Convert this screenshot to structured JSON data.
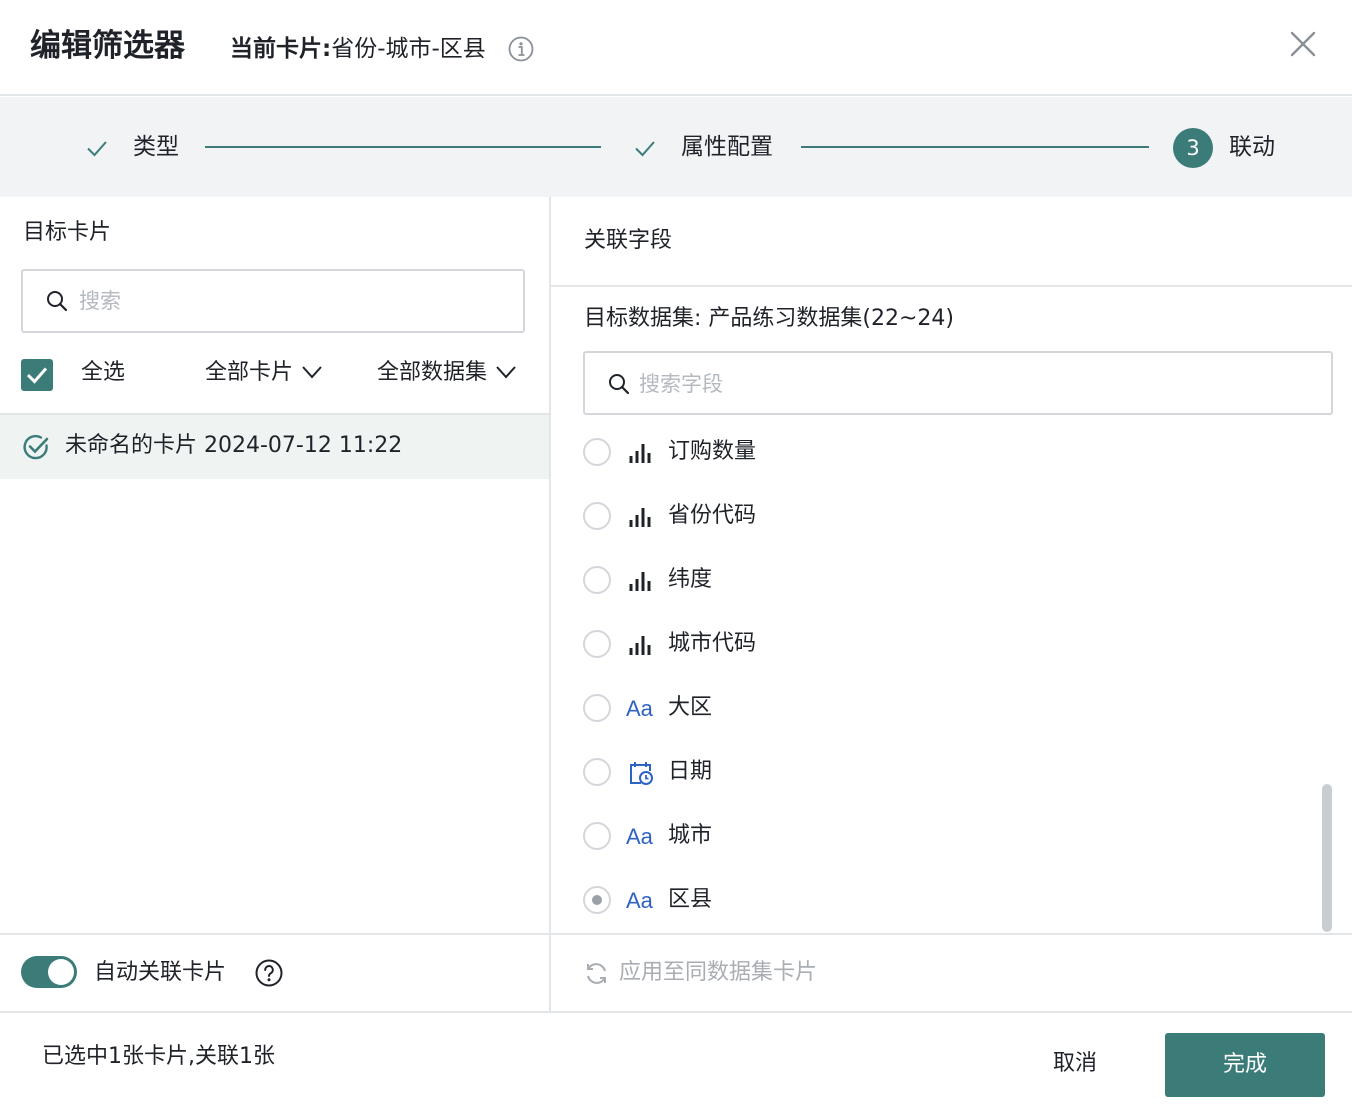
{
  "dialog": {
    "title": "编辑筛选器",
    "current_card_label": "当前卡片:",
    "current_card_value": "省份-城市-区县"
  },
  "steps": [
    {
      "label": "类型",
      "status": "done"
    },
    {
      "label": "属性配置",
      "status": "done"
    },
    {
      "number": "3",
      "label": "联动",
      "status": "active"
    }
  ],
  "left": {
    "title": "目标卡片",
    "search_placeholder": "搜索",
    "select_all_label": "全选",
    "select_all_checked": true,
    "filter_cards": "全部卡片",
    "filter_datasets": "全部数据集",
    "cards": [
      {
        "name": "未命名的卡片 2024-07-12 11:22",
        "checked": true
      }
    ]
  },
  "right": {
    "title": "关联字段",
    "dataset_label": "目标数据集: 产品练习数据集(22~24)",
    "search_placeholder": "搜索字段",
    "fields": [
      {
        "name": "订购数量",
        "type": "measure",
        "icon": "bar-chart-icon",
        "selected": false
      },
      {
        "name": "省份代码",
        "type": "measure",
        "icon": "bar-chart-icon",
        "selected": false
      },
      {
        "name": "纬度",
        "type": "measure",
        "icon": "bar-chart-icon",
        "selected": false
      },
      {
        "name": "城市代码",
        "type": "measure",
        "icon": "bar-chart-icon",
        "selected": false
      },
      {
        "name": "大区",
        "type": "text",
        "icon_text": "Aa",
        "selected": false
      },
      {
        "name": "日期",
        "type": "date",
        "icon": "calendar-icon",
        "selected": false
      },
      {
        "name": "城市",
        "type": "text",
        "icon_text": "Aa",
        "selected": false
      },
      {
        "name": "区县",
        "type": "text",
        "icon_text": "Aa",
        "selected": true
      }
    ]
  },
  "bottom": {
    "auto_link_label": "自动关联卡片",
    "auto_link_on": true,
    "apply_label": "应用至同数据集卡片"
  },
  "footer": {
    "status": "已选中1张卡片,关联1张",
    "cancel_label": "取消",
    "done_label": "完成"
  },
  "colors": {
    "accent": "#3b7c79",
    "text_type_icon": "#2e63c6",
    "selected_row_bg": "#eff3f2",
    "steps_bg": "#f1f3f5"
  }
}
